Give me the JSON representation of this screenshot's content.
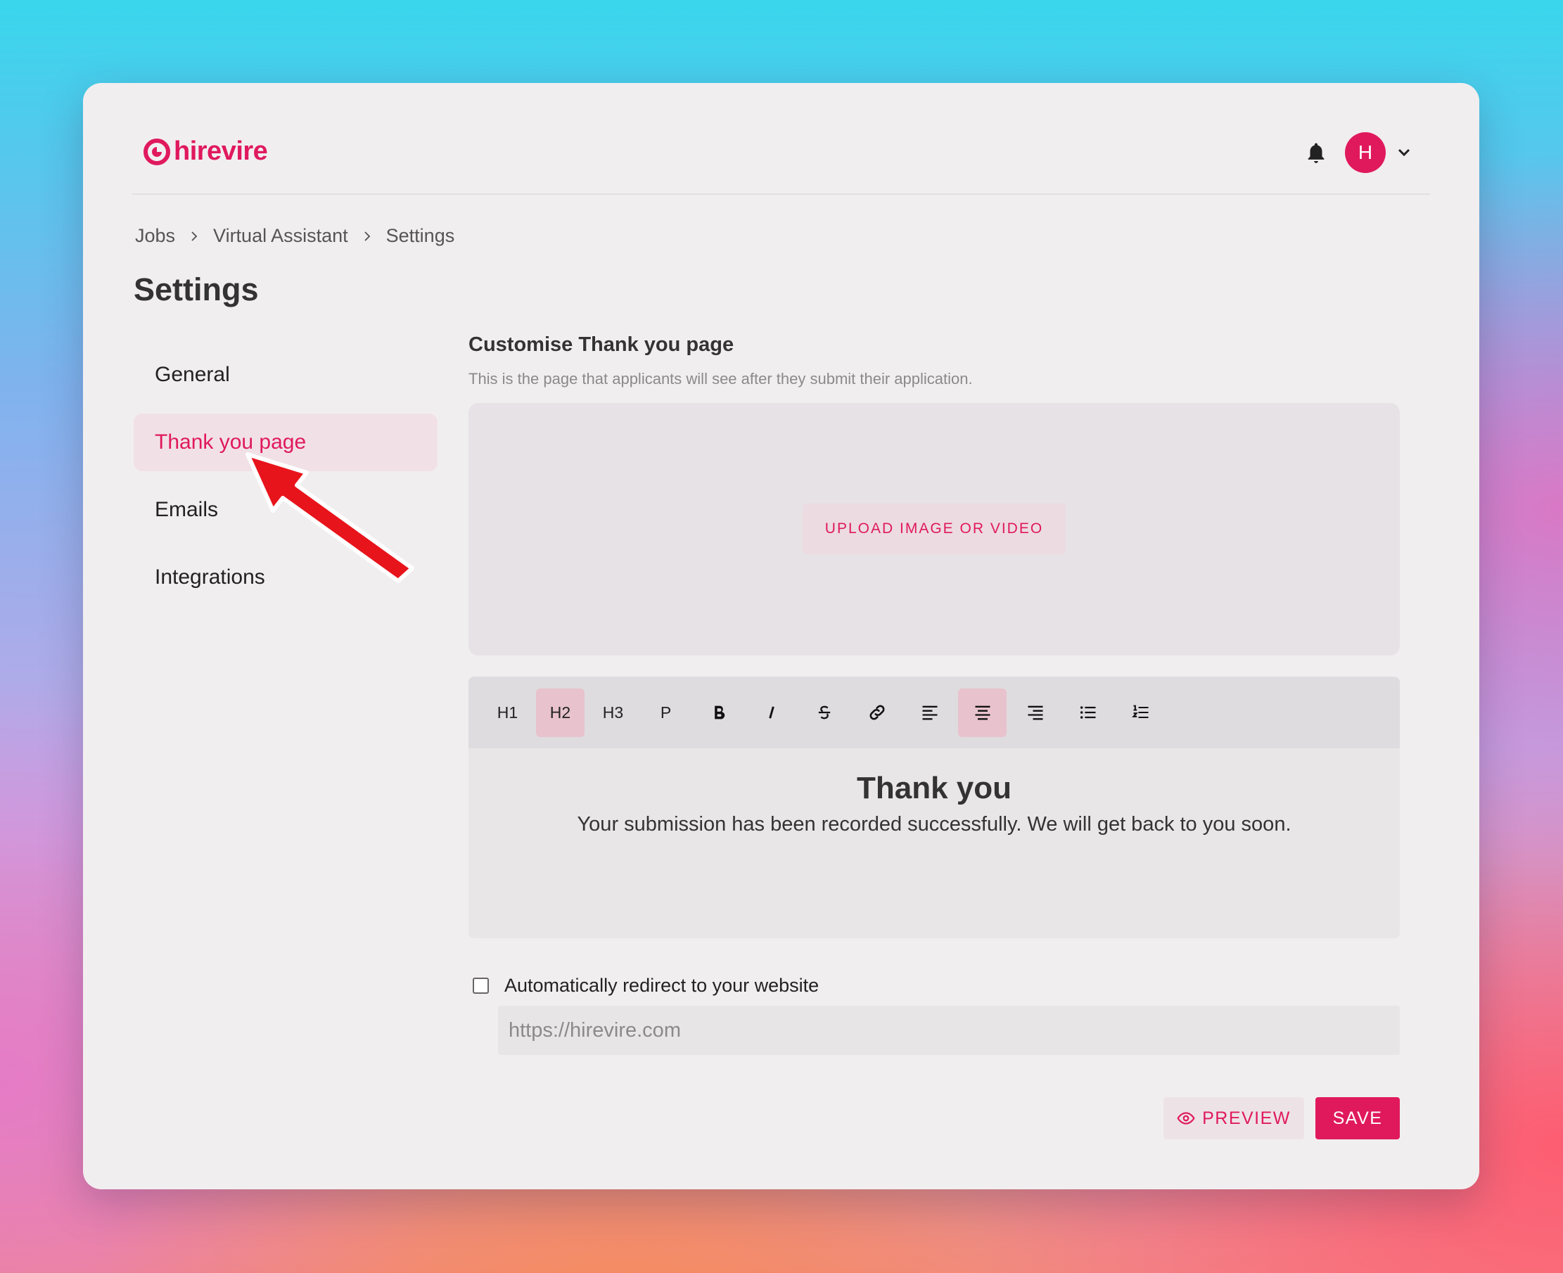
{
  "brand": {
    "name": "hirevire",
    "accent": "#e0195d"
  },
  "user": {
    "avatar_initial": "H"
  },
  "breadcrumb": [
    "Jobs",
    "Virtual Assistant",
    "Settings"
  ],
  "page_title": "Settings",
  "nav": {
    "items": [
      {
        "label": "General"
      },
      {
        "label": "Thank you page",
        "active": true
      },
      {
        "label": "Emails"
      },
      {
        "label": "Integrations"
      }
    ]
  },
  "section": {
    "title": "Customise Thank you page",
    "description": "This is the page that applicants will see after they submit their application."
  },
  "upload": {
    "button_label": "UPLOAD IMAGE OR VIDEO"
  },
  "toolbar": {
    "h1": "H1",
    "h2": "H2",
    "h3": "H3",
    "p": "P",
    "active": [
      "H2",
      "align-center"
    ],
    "icons": [
      "bold-icon",
      "italic-icon",
      "strikethrough-icon",
      "link-icon",
      "align-left-icon",
      "align-center-icon",
      "align-right-icon",
      "bullet-list-icon",
      "numbered-list-icon"
    ]
  },
  "editor": {
    "heading": "Thank you",
    "body": "Your submission has been recorded successfully. We will get back to you soon."
  },
  "redirect": {
    "label": "Automatically redirect to your website",
    "checked": false,
    "placeholder": "https://hirevire.com"
  },
  "actions": {
    "preview_label": "PREVIEW",
    "save_label": "SAVE"
  },
  "annotation": {
    "arrow_color": "#e8141c",
    "points_to": "Thank you page"
  }
}
